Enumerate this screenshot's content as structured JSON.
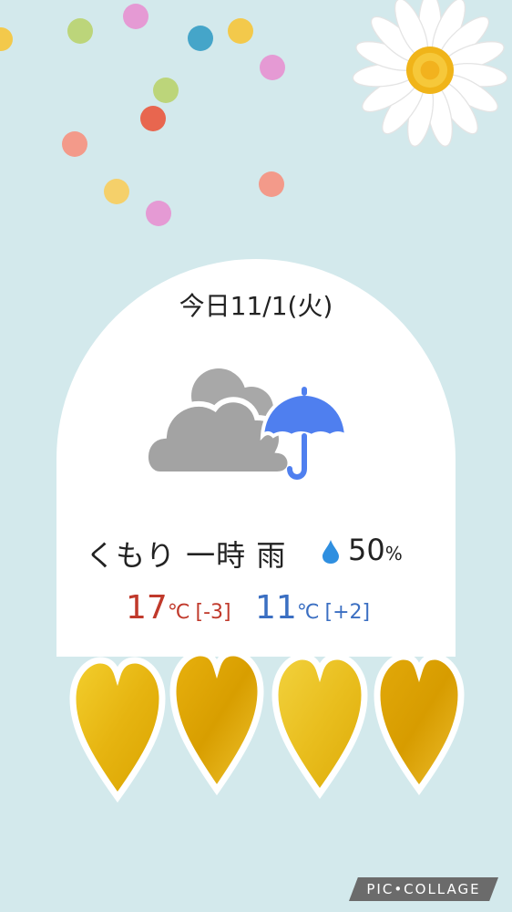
{
  "forecast": {
    "date_label": "今日11/1(火)",
    "condition": "くもり 一時 雨",
    "condition_icon": "cloud-with-umbrella-icon",
    "precipitation_chance": "50",
    "precipitation_unit": "%",
    "high": {
      "value": "17",
      "unit": "℃",
      "diff": "[-3]",
      "color": "#c0392b"
    },
    "low": {
      "value": "11",
      "unit": "℃",
      "diff": "[+2]",
      "color": "#3b6fc2"
    }
  },
  "decorations": {
    "confetti_colors": [
      "#e89ad0",
      "#bcd57a",
      "#4aa6c8",
      "#f2c94c",
      "#f38a7a",
      "#e86a55",
      "#f5d06a"
    ],
    "heart_color": "#e6b400"
  },
  "watermark": "PIC•COLLAGE"
}
